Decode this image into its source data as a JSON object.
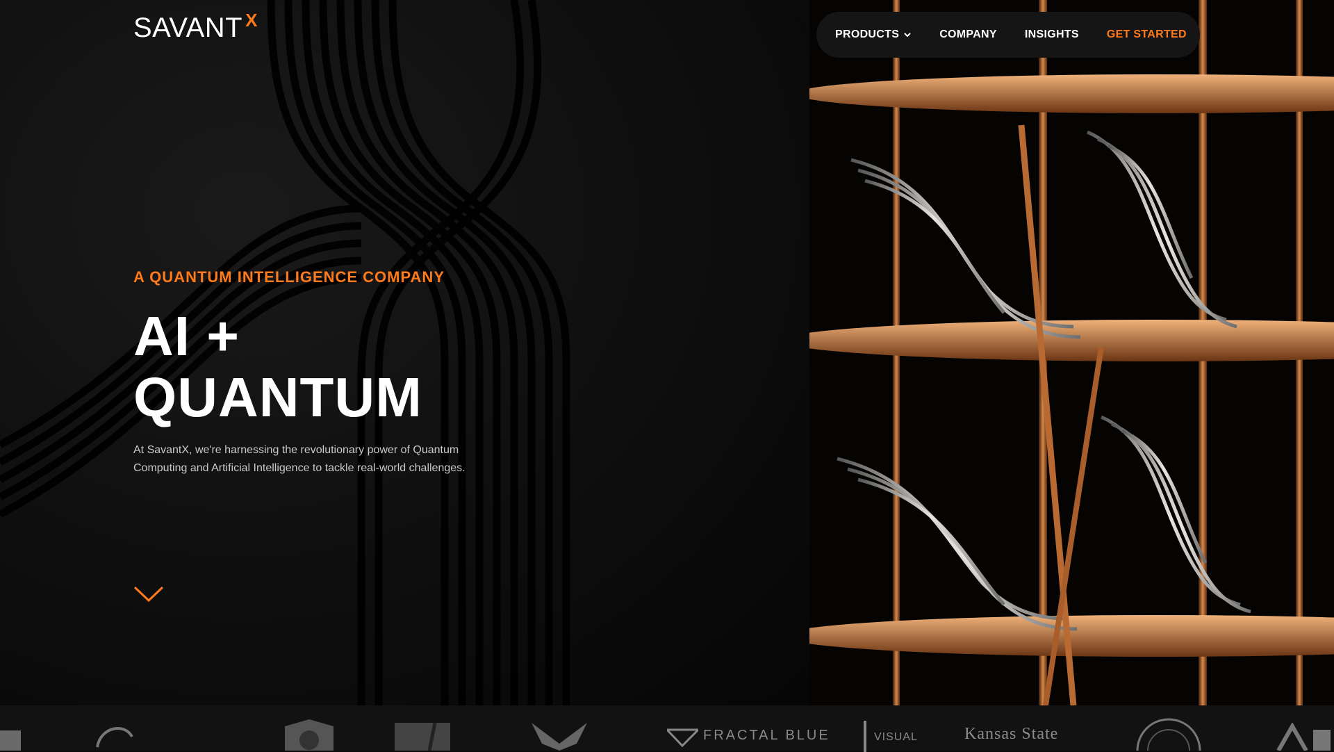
{
  "brand": {
    "name": "SAVANT",
    "superscript": "X"
  },
  "nav": {
    "products": "PRODUCTS",
    "company": "COMPANY",
    "insights": "INSIGHTS",
    "get_started": "GET STARTED"
  },
  "hero": {
    "tagline": "A QUANTUM INTELLIGENCE COMPANY",
    "headline_line1": "AI +",
    "headline_line2": "QUANTUM",
    "description": "At SavantX, we're harnessing the revolutionary power of Quantum Computing and Artificial Intelligence to tackle real-world challenges."
  },
  "partner_logos": {
    "fractal_blue": "FRACTAL BLUE",
    "visual": "VISUAL",
    "kansas_state": "Kansas State"
  },
  "colors": {
    "accent": "#ff7a1a",
    "background": "#0b0b0b",
    "nav_pill": "#151515",
    "copper": "#c46a2c"
  }
}
